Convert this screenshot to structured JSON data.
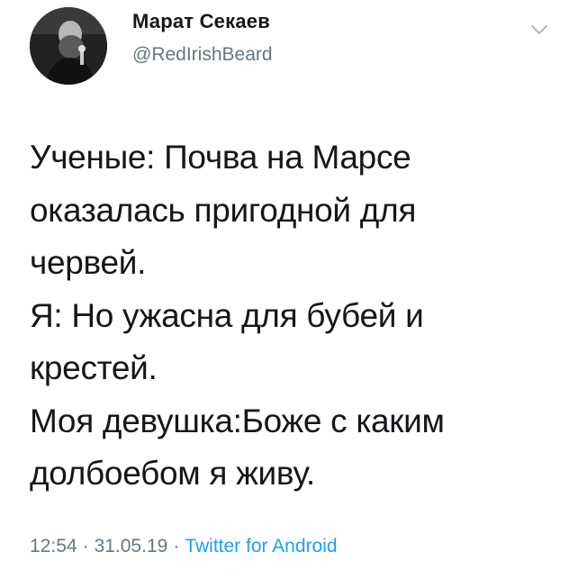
{
  "author": {
    "name": "Марат Секаев",
    "handle": "@RedIrishBeard",
    "avatar_icon": "profile-photo",
    "menu_icon": "chevron-down-icon"
  },
  "tweet": {
    "lines": [
      "Ученые: Почва на Марсе",
      "оказалась пригодной для",
      "червей.",
      "Я: Но ужасна для бубей и",
      "крестей.",
      "Моя девушка:Боже с каким",
      "долбоебом я живу."
    ],
    "time": "12:54",
    "date": "31.05.19",
    "separator": "·",
    "source": "Twitter for Android"
  },
  "colors": {
    "text": "#14171a",
    "secondary": "#657786",
    "link": "#1da1f2",
    "background": "#ffffff"
  }
}
